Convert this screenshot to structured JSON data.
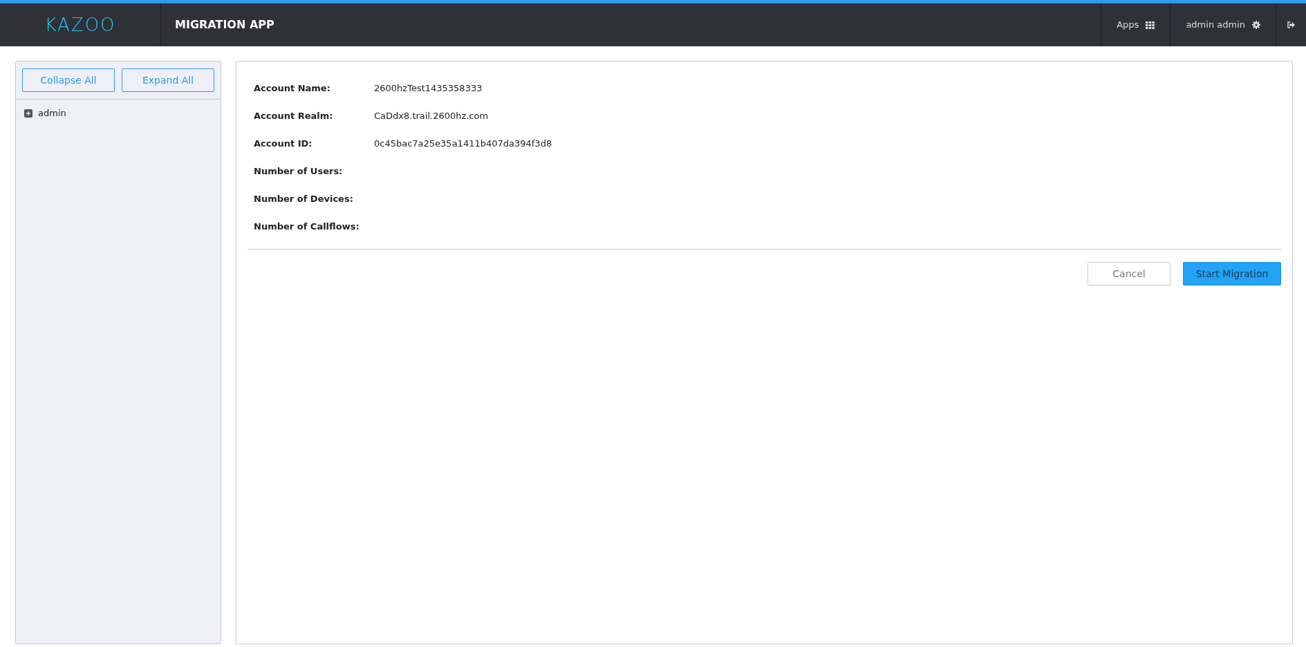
{
  "header": {
    "logo": "KAZOO",
    "app_title": "MIGRATION APP",
    "apps_label": "Apps",
    "user_label": "admin admin"
  },
  "sidebar": {
    "buttons": [
      "Collapse All",
      "Expand All"
    ],
    "tree": [
      {
        "label": "admin",
        "expanded": false
      }
    ]
  },
  "details": [
    {
      "label": "Account Name:",
      "value": "2600hzTest1435358333"
    },
    {
      "label": "Account Realm:",
      "value": "CaDdx8.trail.2600hz.com"
    },
    {
      "label": "Account ID:",
      "value": "0c45bac7a25e35a1411b407da394f3d8"
    },
    {
      "label": "Number of Users:"
    },
    {
      "label": "Number of Devices:"
    },
    {
      "label": "Number of Callflows:"
    }
  ],
  "actions": [
    {
      "label": "Cancel",
      "kind": "secondary"
    },
    {
      "label": "Start Migration",
      "kind": "primary"
    }
  ]
}
